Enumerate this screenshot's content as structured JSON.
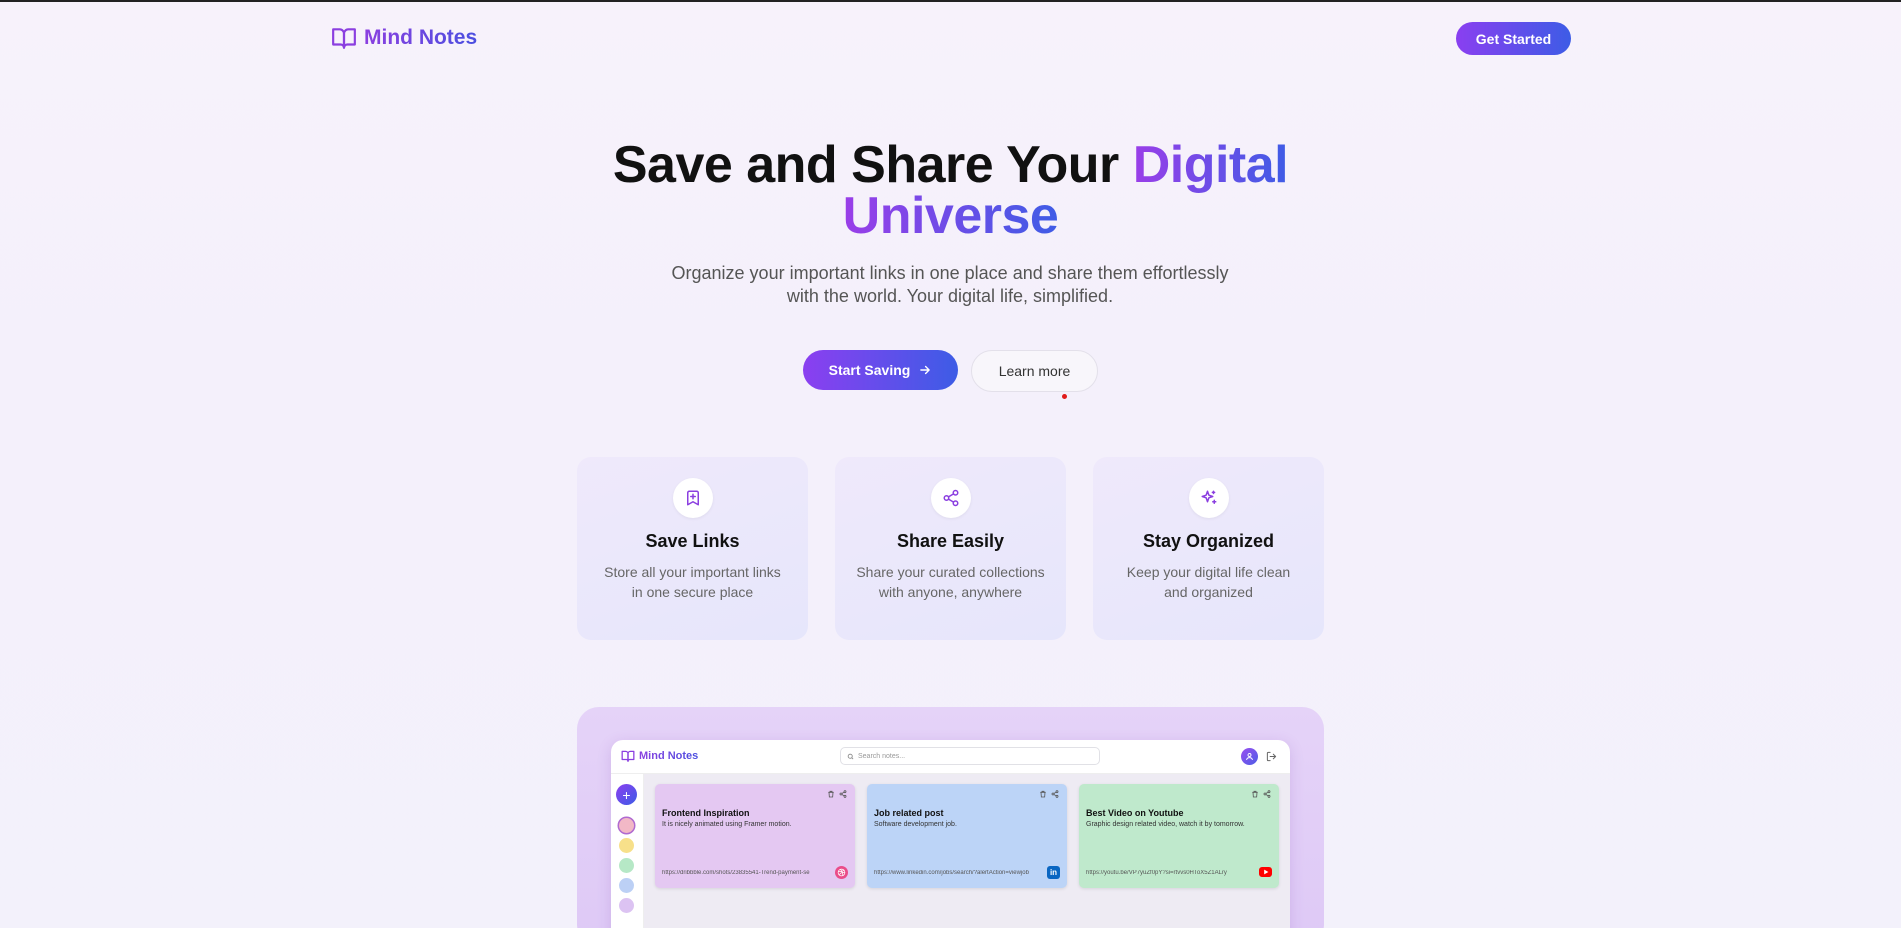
{
  "header": {
    "brand": "Mind Notes",
    "cta_label": "Get Started"
  },
  "hero": {
    "title_part1": "Save and Share Your ",
    "title_highlight1": "Digital",
    "title_highlight2": "Universe",
    "subtitle_line1": "Organize your important links in one place and share them effortlessly",
    "subtitle_line2": "with the world. Your digital life, simplified.",
    "primary_label": "Start Saving",
    "secondary_label": "Learn more"
  },
  "features": [
    {
      "title": "Save Links",
      "desc": "Store all your important links in one secure place",
      "icon": "bookmark-plus-icon"
    },
    {
      "title": "Share Easily",
      "desc": "Share your curated collections with anyone, anywhere",
      "icon": "share-icon"
    },
    {
      "title": "Stay Organized",
      "desc": "Keep your digital life clean and organized",
      "icon": "sparkles-icon"
    }
  ],
  "preview": {
    "brand": "Mind Notes",
    "search_placeholder": "Search notes...",
    "swatch_colors": [
      "#f2b8c6",
      "#f7e08a",
      "#b6e8c6",
      "#bcd0f5",
      "#dcc3f2"
    ],
    "notes": [
      {
        "title": "Frontend Inspiration",
        "desc": "It is nicely animated using Framer motion.",
        "url": "https://dribbble.com/shots/23835541-Trend-payment-se",
        "color": "#e4c8f2",
        "source": "dribbble"
      },
      {
        "title": "Job related post",
        "desc": "Software development job.",
        "url": "https://www.linkedin.com/jobs/search/?alertAction=viewjob",
        "color": "#bcd4f7",
        "source": "linkedin"
      },
      {
        "title": "Best Video on Youtube",
        "desc": "Graphic design related video, watch it by tomorrow.",
        "url": "https://youtu.be/VP7yuZf0pY?si=rtvvs0HToX5Z1ALry",
        "color": "#bfe9cc",
        "source": "youtube"
      }
    ]
  }
}
